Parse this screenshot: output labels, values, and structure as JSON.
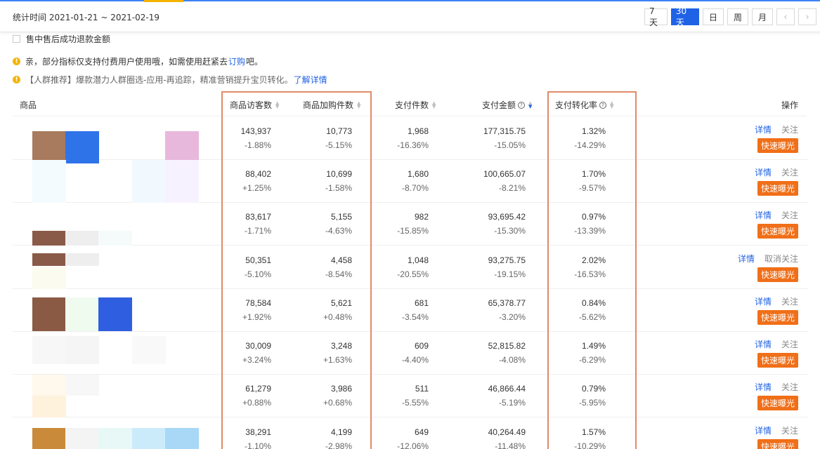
{
  "header": {
    "stat_time": "统计时间 2021-01-21 ~ 2021-02-19",
    "range_buttons": [
      "7天",
      "30天",
      "日",
      "周",
      "月"
    ],
    "active_range": "30天",
    "prev_label": "‹",
    "next_label": "›"
  },
  "options": {
    "after_sale_label": "售中售后成功退款金额"
  },
  "notices": {
    "n1_text": "亲，部分指标仅支持付费用户使用哦，如需使用赶紧去",
    "n1_link": "订购",
    "n1_suffix": "吧。",
    "n2_text": "【人群推荐】爆款潜力人群圈选-应用-再追踪，精准营销提升宝贝转化。",
    "n2_link": "了解详情"
  },
  "table": {
    "headers": {
      "product": "商品",
      "visitors": "商品访客数",
      "cart": "商品加购件数",
      "pay_items": "支付件数",
      "pay_amount": "支付金额",
      "conversion": "支付转化率",
      "actions": "操作"
    },
    "rows": [
      {
        "visitors": "143,937",
        "visitors_chg": "-1.88%",
        "cart": "10,773",
        "cart_chg": "-5.15%",
        "pay_items": "1,968",
        "pay_items_chg": "-16.36%",
        "amount": "177,315.75",
        "amount_chg": "-15.05%",
        "conv": "1.32%",
        "conv_chg": "-14.29%",
        "detail": "详情",
        "follow": "关注",
        "expose": "快速曝光"
      },
      {
        "visitors": "88,402",
        "visitors_chg": "+1.25%",
        "cart": "10,699",
        "cart_chg": "-1.58%",
        "pay_items": "1,680",
        "pay_items_chg": "-8.70%",
        "amount": "100,665.07",
        "amount_chg": "-8.21%",
        "conv": "1.70%",
        "conv_chg": "-9.57%",
        "detail": "详情",
        "follow": "关注",
        "expose": "快速曝光"
      },
      {
        "visitors": "83,617",
        "visitors_chg": "-1.71%",
        "cart": "5,155",
        "cart_chg": "-4.63%",
        "pay_items": "982",
        "pay_items_chg": "-15.85%",
        "amount": "93,695.42",
        "amount_chg": "-15.30%",
        "conv": "0.97%",
        "conv_chg": "-13.39%",
        "detail": "详情",
        "follow": "关注",
        "expose": "快速曝光"
      },
      {
        "visitors": "50,351",
        "visitors_chg": "-5.10%",
        "cart": "4,458",
        "cart_chg": "-8.54%",
        "pay_items": "1,048",
        "pay_items_chg": "-20.55%",
        "amount": "93,275.75",
        "amount_chg": "-19.15%",
        "conv": "2.02%",
        "conv_chg": "-16.53%",
        "detail": "详情",
        "follow": "取消关注",
        "expose": "快速曝光"
      },
      {
        "visitors": "78,584",
        "visitors_chg": "+1.92%",
        "cart": "5,621",
        "cart_chg": "+0.48%",
        "pay_items": "681",
        "pay_items_chg": "-3.54%",
        "amount": "65,378.77",
        "amount_chg": "-3.20%",
        "conv": "0.84%",
        "conv_chg": "-5.62%",
        "detail": "详情",
        "follow": "关注",
        "expose": "快速曝光"
      },
      {
        "visitors": "30,009",
        "visitors_chg": "+3.24%",
        "cart": "3,248",
        "cart_chg": "+1.63%",
        "pay_items": "609",
        "pay_items_chg": "-4.40%",
        "amount": "52,815.82",
        "amount_chg": "-4.08%",
        "conv": "1.49%",
        "conv_chg": "-6.29%",
        "detail": "详情",
        "follow": "关注",
        "expose": "快速曝光"
      },
      {
        "visitors": "61,279",
        "visitors_chg": "+0.88%",
        "cart": "3,986",
        "cart_chg": "+0.68%",
        "pay_items": "511",
        "pay_items_chg": "-5.55%",
        "amount": "46,866.44",
        "amount_chg": "-5.19%",
        "conv": "0.79%",
        "conv_chg": "-5.95%",
        "detail": "详情",
        "follow": "关注",
        "expose": "快速曝光"
      },
      {
        "visitors": "38,291",
        "visitors_chg": "-1.10%",
        "cart": "4,199",
        "cart_chg": "-2.98%",
        "pay_items": "649",
        "pay_items_chg": "-12.06%",
        "amount": "40,264.49",
        "amount_chg": "-11.48%",
        "conv": "1.57%",
        "conv_chg": "-10.29%",
        "detail": "详情",
        "follow": "关注",
        "expose": "快速曝光"
      }
    ]
  },
  "colors": {
    "accent": "#2062e6",
    "expose_button": "#f06f18",
    "highlight_box": "#e08a6a",
    "notice_dot": "#f5b400"
  }
}
